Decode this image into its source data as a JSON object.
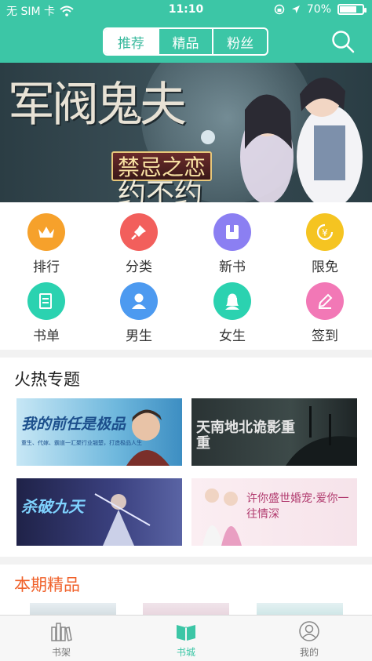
{
  "status": {
    "carrier": "无 SIM 卡",
    "time": "11:10",
    "battery": "70%"
  },
  "header": {
    "tabs": [
      {
        "label": "推荐",
        "active": true
      },
      {
        "label": "精品",
        "active": false
      },
      {
        "label": "粉丝",
        "active": false
      }
    ],
    "search_icon": "search-icon"
  },
  "banner": {
    "title_left": "军阀鬼夫",
    "title_tag": "禁忌之恋",
    "title_right": "约不约"
  },
  "categories": [
    {
      "label": "排行",
      "icon": "crown-icon",
      "color": "#f6a12b"
    },
    {
      "label": "分类",
      "icon": "pin-icon",
      "color": "#f25f5c"
    },
    {
      "label": "新书",
      "icon": "book-icon",
      "color": "#8b7ff2"
    },
    {
      "label": "限免",
      "icon": "free-icon",
      "color": "#f5c421"
    },
    {
      "label": "书单",
      "icon": "booklist-icon",
      "color": "#2bd2b0"
    },
    {
      "label": "男生",
      "icon": "male-icon",
      "color": "#4d9af0"
    },
    {
      "label": "女生",
      "icon": "female-icon",
      "color": "#2bd2b0"
    },
    {
      "label": "签到",
      "icon": "pencil-icon",
      "color": "#f278b6"
    }
  ],
  "topics": {
    "title": "火热专题",
    "cards": [
      {
        "caption": "我的前任是极品",
        "subcaption": "重生、代嫁、霸道一汇聚行业翘楚，打造极品人生"
      },
      {
        "caption": "天南地北诡影重重",
        "subcaption": ""
      },
      {
        "caption": "杀破九天",
        "subcaption": ""
      },
      {
        "caption": "许你盛世婚宠·爱你一往情深",
        "subcaption": ""
      }
    ]
  },
  "featured": {
    "title": "本期精品"
  },
  "bottom_nav": [
    {
      "label": "书架",
      "icon": "bookshelf-icon",
      "active": false
    },
    {
      "label": "书城",
      "icon": "open-book-icon",
      "active": true
    },
    {
      "label": "我的",
      "icon": "profile-icon",
      "active": false
    }
  ],
  "colors": {
    "accent": "#3cc6a6",
    "featured_title": "#f0612a"
  }
}
